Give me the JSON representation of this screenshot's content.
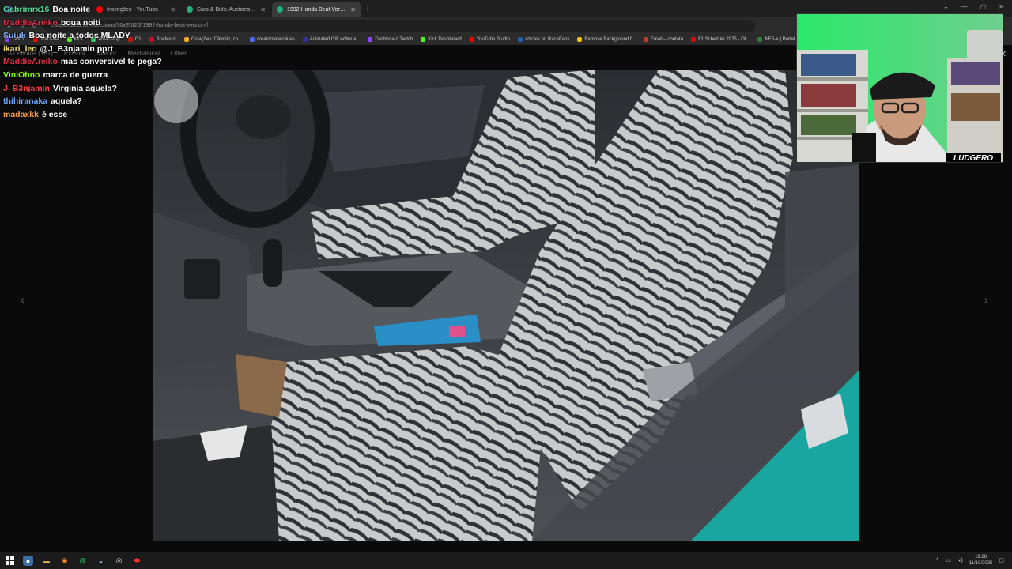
{
  "browser": {
    "tabs": [
      {
        "title": "",
        "color": "#9146ff",
        "active": false
      },
      {
        "title": "Inscrições - YouTube",
        "color": "#ff0000",
        "active": false
      },
      {
        "title": "Cars & Bids: Auctions of cool ca",
        "color": "#1db47c",
        "active": false
      },
      {
        "title": "1992 Honda Beat Version F Wit",
        "color": "#1db47c",
        "active": true
      }
    ],
    "new_tab": "+",
    "url": "carsandbids.com/auctions/30xE0I2G/1992-honda-beat-version-f",
    "bookmarks": [
      {
        "label": "Twitch",
        "color": "#9146ff"
      },
      {
        "label": "YouTube",
        "color": "#ff0000"
      },
      {
        "label": "Kick",
        "color": "#53fc18"
      },
      {
        "label": "WhatsApp",
        "color": "#25d366"
      },
      {
        "label": "G1",
        "color": "#c4170c"
      },
      {
        "label": "Bradesco",
        "color": "#cc092f"
      },
      {
        "label": "Cotações: Câmbio, co...",
        "color": "#f5a623"
      },
      {
        "label": "creatornetwork.es",
        "color": "#4a6cf7"
      },
      {
        "label": "Animated GIF editor a...",
        "color": "#333399"
      },
      {
        "label": "Dashboard Twitch",
        "color": "#9146ff"
      },
      {
        "label": "Kick Dashboard",
        "color": "#53fc18"
      },
      {
        "label": "YouTube Studio",
        "color": "#ff0000"
      },
      {
        "label": "articles on RaceFans",
        "color": "#2a5db0"
      },
      {
        "label": "Remove Background f...",
        "color": "#f0c000"
      },
      {
        "label": "Email – contato",
        "color": "#c0392b"
      },
      {
        "label": "F1 Schedule 2025 - Of...",
        "color": "#e10600"
      },
      {
        "label": "NFS-e | Portal Contri...",
        "color": "#2e7d32"
      }
    ]
  },
  "gallery": {
    "filters": [
      "All Photos (181)",
      "Exterior",
      "Interior",
      "Mechanical",
      "Other"
    ],
    "prev_arrow": "‹",
    "next_arrow": "›"
  },
  "chat": [
    {
      "user": "Gabrimrx16",
      "text": "Boa noite",
      "color": "#4ee0a0"
    },
    {
      "user": "MaddieAreiko",
      "text": "boua noiti",
      "color": "#e0304a"
    },
    {
      "user": "Suiuk",
      "text": "Boa noite a todos MLADY",
      "color": "#8ab4f8"
    },
    {
      "user": "ikari_leo",
      "text": "@J_B3njamin pprt",
      "color": "#f0e060"
    },
    {
      "user": "MaddieAreiko",
      "text": "mas conversivel te pega?",
      "color": "#e0304a"
    },
    {
      "user": "ViniOhno",
      "text": "marca de guerra",
      "color": "#7cfc00"
    },
    {
      "user": "J_B3njamin",
      "text": "Virginia aquela?",
      "color": "#ff4040"
    },
    {
      "user": "thihiranaka",
      "text": "aquela?",
      "color": "#6fa8ff"
    },
    {
      "user": "madaxkk",
      "text": "é esse",
      "color": "#ffa040"
    }
  ],
  "webcam": {
    "watermark": "LUDGERO"
  },
  "taskbar": {
    "time": "19:28",
    "date": "11/10/2025"
  }
}
